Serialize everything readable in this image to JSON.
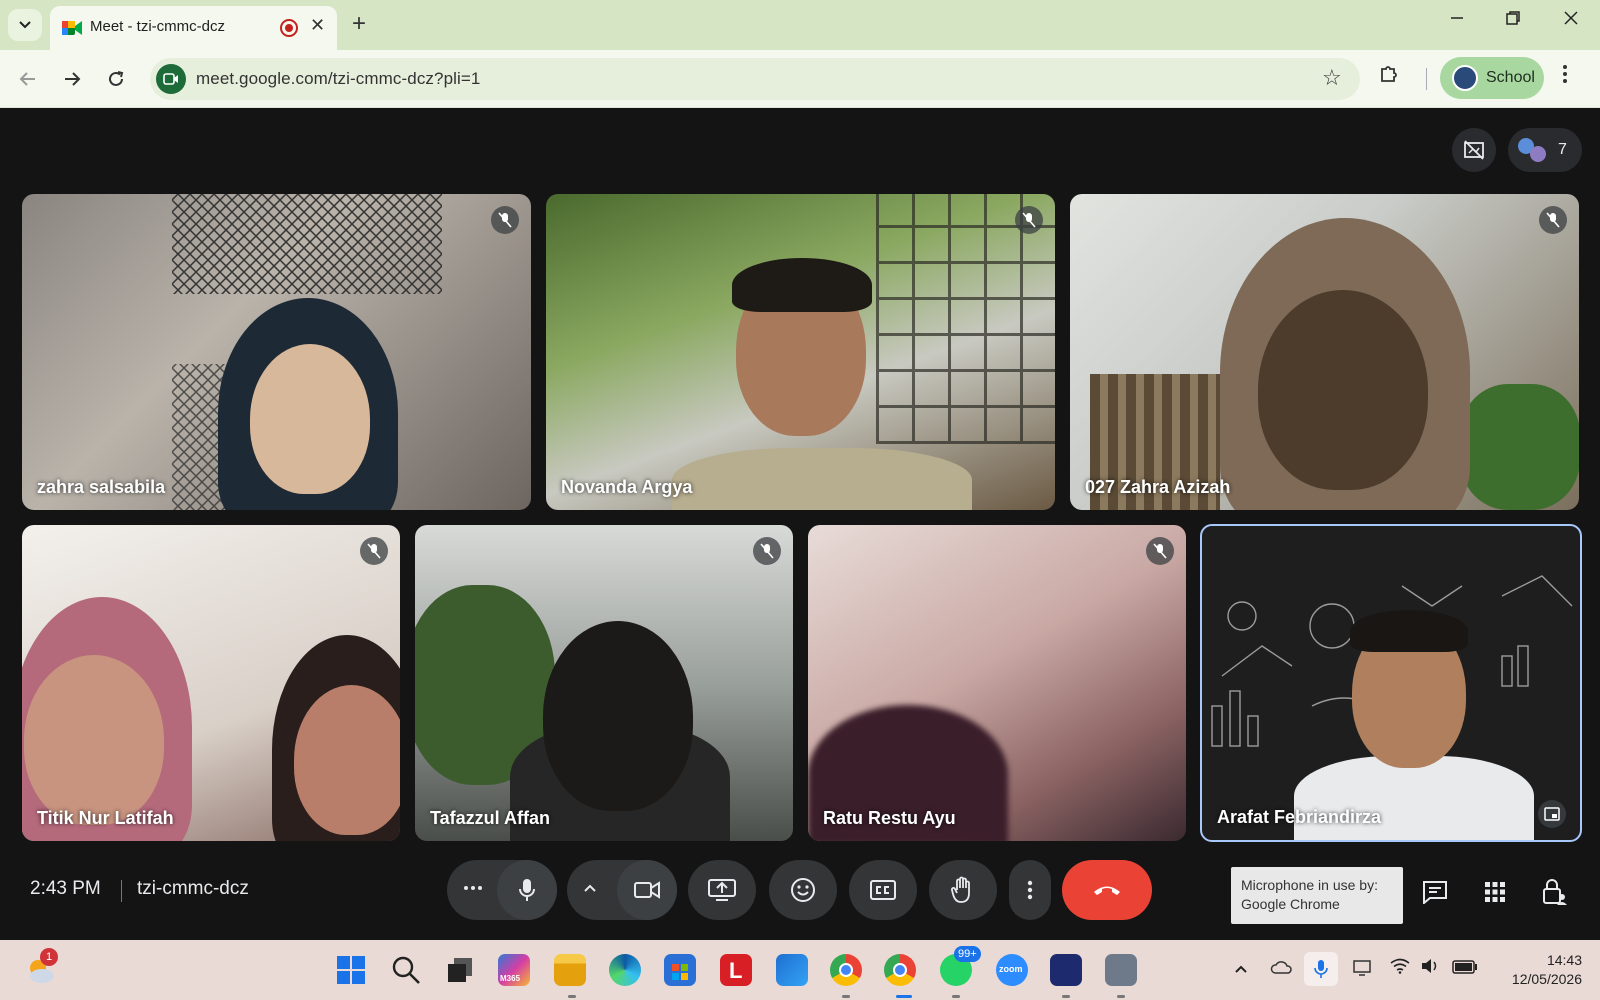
{
  "browser": {
    "tab_title": "Meet - tzi-cmmc-dcz",
    "url": "meet.google.com/tzi-cmmc-dcz?pli=1",
    "profile_label": "School",
    "new_tab_glyph": "+",
    "close_glyph": "✕"
  },
  "meet": {
    "participant_count": "7",
    "time": "2:43 PM",
    "meeting_code": "tzi-cmmc-dcz",
    "participants": [
      {
        "name": "zahra salsabila",
        "muted": true
      },
      {
        "name": "Novanda Argya",
        "muted": true
      },
      {
        "name": "027 Zahra Azizah",
        "muted": true
      },
      {
        "name": "Titik Nur Latifah",
        "muted": true
      },
      {
        "name": "Tafazzul Affan",
        "muted": true
      },
      {
        "name": "Ratu Restu Ayu",
        "muted": true
      },
      {
        "name": "Arafat Febriandirza",
        "muted": false
      }
    ],
    "mic_notice_line1": "Microphone in use by:",
    "mic_notice_line2": "Google Chrome"
  },
  "taskbar": {
    "notification_badge": "1",
    "whatsapp_badge": "99+",
    "clock_time": "14:43",
    "clock_date": "12/05/2026",
    "office_label": "M365",
    "zoom_label": "zoom",
    "l_app_letter": "L"
  },
  "colors": {
    "meet_bg": "#141414",
    "end_call": "#ea4335",
    "chrome_tabstrip": "#d6e6c4",
    "active_speaker_border": "#a8c7fa"
  }
}
